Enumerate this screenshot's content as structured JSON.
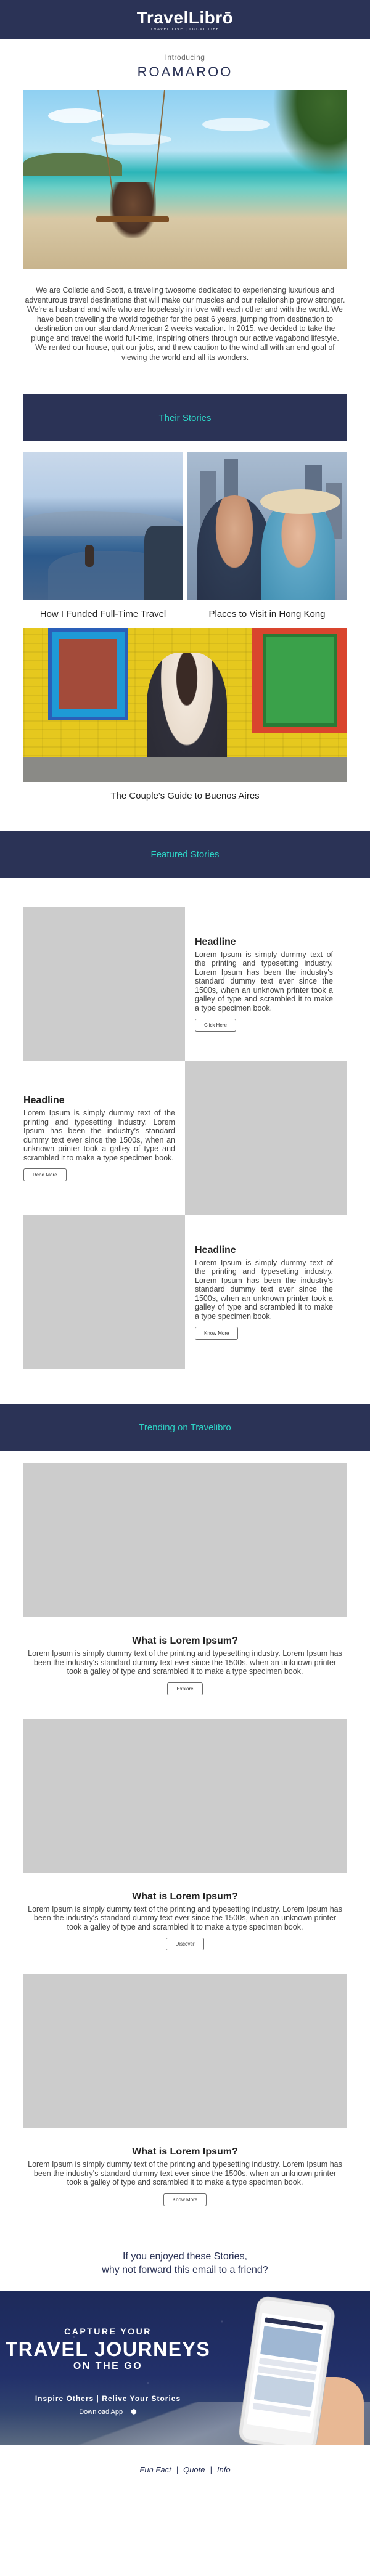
{
  "brand": {
    "logo_text": "TravelLibrō",
    "tagline": "TRAVEL LIVE  |  LOCAL LIFE"
  },
  "intro": {
    "label": "Introducing",
    "name": "ROAMAROO"
  },
  "bio": "We are Collette and Scott, a traveling twosome dedicated to experiencing luxurious and adventurous travel destinations that will make our muscles and our relationship grow stronger. We're a husband and wife who are hopelessly in love with each other and with the world.  We have been traveling the world together for the past 6 years, jumping from destination to destination on our standard American 2 weeks vacation. In 2015, we decided to take the plunge and travel the world full-time, inspiring others through our active vagabond lifestyle.  We rented our house, quit our jobs, and threw caution to the wind all with an end goal of viewing the world and all its wonders.",
  "their_stories": {
    "heading": "Their Stories",
    "items": [
      {
        "title": "How I Funded Full-Time Travel"
      },
      {
        "title": "Places to Visit in Hong Kong"
      },
      {
        "title": "The Couple's Guide to Buenos Aires"
      }
    ]
  },
  "featured": {
    "heading": "Featured Stories",
    "items": [
      {
        "headline": "Headline",
        "body": "Lorem Ipsum is simply dummy text of the printing and typesetting industry. Lorem Ipsum has been the industry's standard dummy text ever since the 1500s, when an unknown printer took a galley of type and scrambled it to make a type specimen book.",
        "button": "Click Here"
      },
      {
        "headline": "Headline",
        "body": "Lorem Ipsum is simply dummy text of the printing and typesetting industry. Lorem Ipsum has been the industry's standard dummy text ever since the 1500s, when an unknown printer took a galley of type and scrambled it to make a type specimen book.",
        "button": "Read More"
      },
      {
        "headline": "Headline",
        "body": "Lorem Ipsum is simply dummy text of the printing and typesetting industry. Lorem Ipsum has been the industry's standard dummy text ever since the 1500s, when an unknown printer took a galley of type and scrambled it to make a type specimen book.",
        "button": "Know More"
      }
    ]
  },
  "trending": {
    "heading": "Trending on Travelibro",
    "items": [
      {
        "title": "What is Lorem Ipsum?",
        "body": "Lorem Ipsum is simply dummy text of the printing and typesetting industry. Lorem Ipsum has been the industry's standard dummy text ever since the 1500s, when an unknown printer took a galley of type and scrambled it to make a type specimen book.",
        "button": "Explore"
      },
      {
        "title": "What is Lorem Ipsum?",
        "body": "Lorem Ipsum is simply dummy text of the printing and typesetting industry. Lorem Ipsum has been the industry's standard dummy text ever since the 1500s, when an unknown printer took a galley of type and scrambled it to make a type specimen book.",
        "button": "Discover"
      },
      {
        "title": "What is Lorem Ipsum?",
        "body": "Lorem Ipsum is simply dummy text of the printing and typesetting industry. Lorem Ipsum has been the industry's standard dummy text ever since the 1500s, when an unknown printer took a galley of type and scrambled it to make a type specimen book.",
        "button": "Know More"
      }
    ]
  },
  "share": {
    "line1": "If you enjoyed these Stories,",
    "line2": "why not forward this email to a friend?"
  },
  "promo": {
    "line1": "CAPTURE YOUR",
    "line2": "TRAVEL JOURNEYS",
    "line3": "ON THE GO",
    "line4": "Inspire Others | Relive Your Stories",
    "download": "Download App",
    "apple_glyph": "",
    "android_glyph": "⬢"
  },
  "footer": {
    "links": [
      "Fun Fact",
      "Quote",
      "Info"
    ],
    "separator": "|"
  },
  "colors": {
    "navy": "#2b3356",
    "teal": "#2dd4c5",
    "placeholder": "#cccccc"
  }
}
